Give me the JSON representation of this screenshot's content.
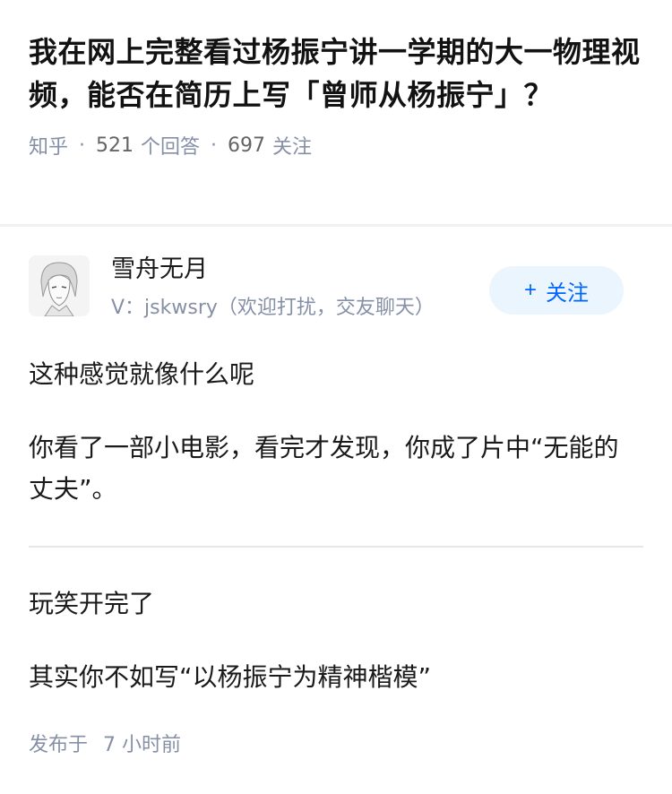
{
  "question": {
    "title": "我在网上完整看过杨振宁讲一学期的大一物理视频，能否在简历上写「曾师从杨振宁」？",
    "source": "知乎",
    "answers_count": "521",
    "answers_label": "个回答",
    "follows_count": "697",
    "follows_label": "关注"
  },
  "answer": {
    "author": {
      "name": "雪舟无月",
      "bio": "V：jskwsry（欢迎打扰，交友聊天）",
      "avatar_icon": "user-avatar-icon"
    },
    "follow_button_label": "关注",
    "paragraphs": [
      "这种感觉就像什么呢",
      "你看了一部小电影，看完才发现，你成了片中“无能的丈夫”。",
      "玩笑开完了",
      "其实你不如写“以杨振宁为精神楷模”"
    ],
    "posted_label": "发布于",
    "posted_time": "7 小时前"
  },
  "colors": {
    "accent": "#0066ff",
    "meta": "#8590a6",
    "follow_bg": "#ebf5fd"
  }
}
